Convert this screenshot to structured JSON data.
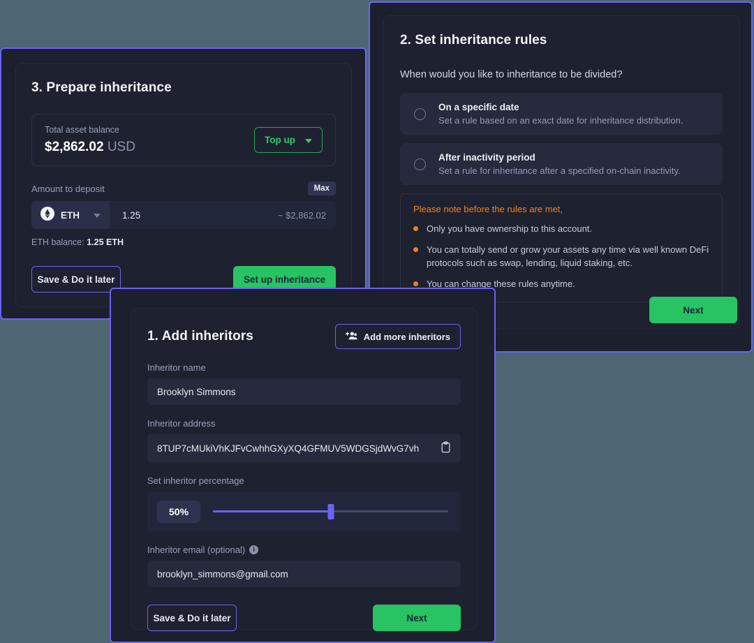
{
  "rules_panel": {
    "title": "2. Set inheritance rules",
    "question": "When would you like to inheritance to be divided?",
    "options": [
      {
        "title": "On a specific date",
        "description": "Set a rule based on an exact date for inheritance distribution."
      },
      {
        "title": "After inactivity period",
        "description": "Set a rule for inheritance after a specified on-chain inactivity."
      }
    ],
    "notice": {
      "heading": "Please note before the rules are met,",
      "items": [
        "Only you have ownership to this account.",
        "You can totally send or grow your assets any time via well known DeFi protocols such as swap, lending, liquid staking, etc.",
        "You can change these rules anytime."
      ]
    },
    "next_label": "Next"
  },
  "prepare_panel": {
    "title": "3. Prepare inheritance",
    "balance_label": "Total asset balance",
    "balance_amount": "$2,862.02",
    "balance_currency": "USD",
    "topup_label": "Top up",
    "deposit_label": "Amount to deposit",
    "max_label": "Max",
    "token": "ETH",
    "amount": "1.25",
    "amount_usd": "~ $2,862.02",
    "balance_hint_label": "ETH balance:",
    "balance_hint_value": "1.25 ETH",
    "save_label": "Save & Do it later",
    "primary_label": "Set up inheritance"
  },
  "inheritors_panel": {
    "title": "1. Add inheritors",
    "add_more_label": "Add more inheritors",
    "name_label": "Inheritor name",
    "name_value": "Brooklyn Simmons",
    "address_label": "Inheritor address",
    "address_value": "8TUP7cMUkiVhKJFvCwhhGXyXQ4GFMUV5WDGSjdWvG7vh",
    "percentage_label": "Set inheritor percentage",
    "percentage_value": "50%",
    "percentage_number": 50,
    "email_label": "Inheritor email (optional)",
    "email_value": "brooklyn_simmons@gmail.com",
    "save_label": "Save & Do it later",
    "next_label": "Next"
  },
  "colors": {
    "page_background": "#4d6672",
    "panel_border": "#6c63f5",
    "panel_background": "#1e2130",
    "accent_green": "#28c463",
    "accent_orange": "#f08221",
    "accent_purple": "#6c63f5"
  }
}
